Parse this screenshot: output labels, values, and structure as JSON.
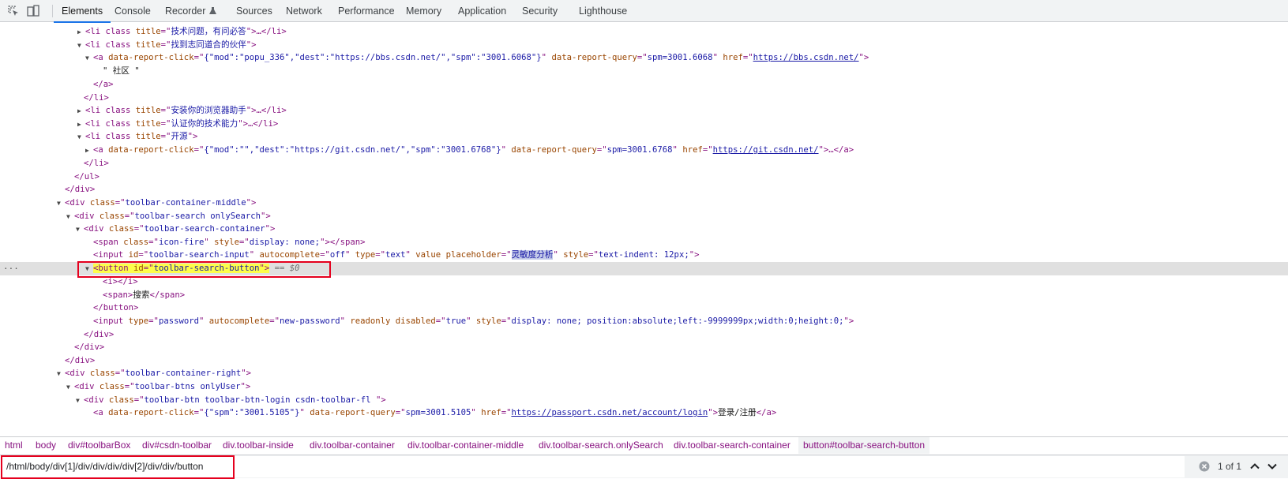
{
  "tabs": [
    "Elements",
    "Console",
    "Recorder",
    "Sources",
    "Network",
    "Performance",
    "Memory",
    "Application",
    "Security",
    "Lighthouse"
  ],
  "recorder_icon": "flask-icon",
  "icons": {
    "inspect": "inspect-icon",
    "device": "device-toggle-icon",
    "clear": "clear-icon",
    "prev": "chevron-up-icon",
    "next": "chevron-down-icon"
  },
  "colors": {
    "tag": "#881280",
    "attr_name": "#994500",
    "attr_value": "#1a1aa6",
    "selection": "#e0e0e0",
    "highlight": "#fdfd4a",
    "red_box": "#e5001e",
    "accent": "#1a73e8"
  },
  "tree": {
    "l0": {
      "p1": "<li class ",
      "a1": "title",
      "eq": "=\"",
      "v1": "技术问题，有问必答",
      "p2": "\">…</li>"
    },
    "l1": {
      "p1": "<li class ",
      "a1": "title",
      "eq": "=\"",
      "v1": "找到志同道合的伙伴",
      "p2": "\">"
    },
    "l2": {
      "p1": "<a ",
      "a1": "data-report-click",
      "e1": "=\"",
      "v1": "{\"mod\":\"popu_336\",\"dest\":\"https://bbs.csdn.net/\",\"spm\":\"3001.6068\"}",
      "q1": "\" ",
      "a2": "data-report-query",
      "e2": "=\"",
      "v2": "spm=3001.6068",
      "q2": "\" ",
      "a3": "href",
      "e3": "=\"",
      "link": "https://bbs.csdn.net/",
      "p2": "\">"
    },
    "l3": "\" 社区 \"",
    "l4": "</a>",
    "l5": "</li>",
    "l6": {
      "p1": "<li class ",
      "a1": "title",
      "eq": "=\"",
      "v1": "安装你的浏览器助手",
      "p2": "\">…</li>"
    },
    "l7": {
      "p1": "<li class ",
      "a1": "title",
      "eq": "=\"",
      "v1": "认证你的技术能力",
      "p2": "\">…</li>"
    },
    "l8": {
      "p1": "<li class ",
      "a1": "title",
      "eq": "=\"",
      "v1": "开源",
      "p2": "\">"
    },
    "l9": {
      "p1": "<a ",
      "a1": "data-report-click",
      "e1": "=\"",
      "v1": "{\"mod\":\"\",\"dest\":\"https://git.csdn.net/\",\"spm\":\"3001.6768\"}",
      "q1": "\" ",
      "a2": "data-report-query",
      "e2": "=\"",
      "v2": "spm=3001.6768",
      "q2": "\" ",
      "a3": "href",
      "e3": "=\"",
      "link": "https://git.csdn.net/",
      "p2": "\">…</a>"
    },
    "l10": "</li>",
    "l11": "</ul>",
    "l12": "</div>",
    "l13": {
      "p1": "<div ",
      "a1": "class",
      "eq": "=\"",
      "v1": "toolbar-container-middle",
      "p2": "\">"
    },
    "l14": {
      "p1": "<div ",
      "a1": "class",
      "eq": "=\"",
      "v1": "toolbar-search onlySearch",
      "p2": "\">"
    },
    "l15": {
      "p1": "<div ",
      "a1": "class",
      "eq": "=\"",
      "v1": "toolbar-search-container",
      "p2": "\">"
    },
    "l16": {
      "p1": "<span ",
      "a1": "class",
      "e1": "=\"",
      "v1": "icon-fire",
      "q1": "\" ",
      "a2": "style",
      "e2": "=\"",
      "v2": "display: none;",
      "p2": "\"></span>"
    },
    "l17": {
      "p1": "<input ",
      "a1": "id",
      "e1": "=\"",
      "v1": "toolbar-search-input",
      "q1": "\" ",
      "a2": "autocomplete",
      "e2": "=\"",
      "v2": "off",
      "q2": "\" ",
      "a3": "type",
      "e3": "=\"",
      "v3": "text",
      "q3": "\" ",
      "a4": "value placeholder",
      "e4": "=\"",
      "v4": "灵敏度分析",
      "q4": "\" ",
      "a5": "style",
      "e5": "=\"",
      "v5": "text-indent: 12px;",
      "p2": "\">"
    },
    "l18": {
      "p1": "<button ",
      "a1": "id",
      "eq": "=\"",
      "v1": "toolbar-search-button",
      "p2": "\">",
      "suffix": " == $0",
      "ellipsis": "···"
    },
    "l19": "<i></i>",
    "l20": {
      "p1": "<span>",
      "t": "搜索",
      "p2": "</span>"
    },
    "l21": "</button>",
    "l22": {
      "p1": "<input ",
      "a1": "type",
      "e1": "=\"",
      "v1": "password",
      "q1": "\" ",
      "a2": "autocomplete",
      "e2": "=\"",
      "v2": "new-password",
      "q2": "\" ",
      "a3": "readonly disabled",
      "e3": "=\"",
      "v3": "true",
      "q3": "\" ",
      "a4": "style",
      "e4": "=\"",
      "v4": "display: none; position:absolute;left:-9999999px;width:0;height:0;",
      "p2": "\">"
    },
    "l23": "</div>",
    "l24": "</div>",
    "l25": "</div>",
    "l26": {
      "p1": "<div ",
      "a1": "class",
      "eq": "=\"",
      "v1": "toolbar-container-right",
      "p2": "\">"
    },
    "l27": {
      "p1": "<div ",
      "a1": "class",
      "eq": "=\"",
      "v1": "toolbar-btns onlyUser",
      "p2": "\">"
    },
    "l28": {
      "p1": "<div ",
      "a1": "class",
      "eq": "=\"",
      "v1": "toolbar-btn toolbar-btn-login csdn-toolbar-fl ",
      "p2": "\">"
    },
    "l29": {
      "p1": "<a ",
      "a1": "data-report-click",
      "e1": "=\"",
      "v1": "{\"spm\":\"3001.5105\"}",
      "q1": "\" ",
      "a2": "data-report-query",
      "e2": "=\"",
      "v2": "spm=3001.5105",
      "q2": "\" ",
      "a3": "href",
      "e3": "=\"",
      "link": "https://passport.csdn.net/account/login",
      "p2": "\">",
      "t": "登录/注册",
      "p3": "</a>"
    }
  },
  "breadcrumb": [
    "html",
    "body",
    "div#toolbarBox",
    "div#csdn-toolbar",
    "div.toolbar-inside",
    "div.toolbar-container",
    "div.toolbar-container-middle",
    "div.toolbar-search.onlySearch",
    "div.toolbar-search-container",
    "button#toolbar-search-button"
  ],
  "search": {
    "value": "/html/body/div[1]/div/div/div/div[2]/div/div/button",
    "count": "1 of 1"
  }
}
